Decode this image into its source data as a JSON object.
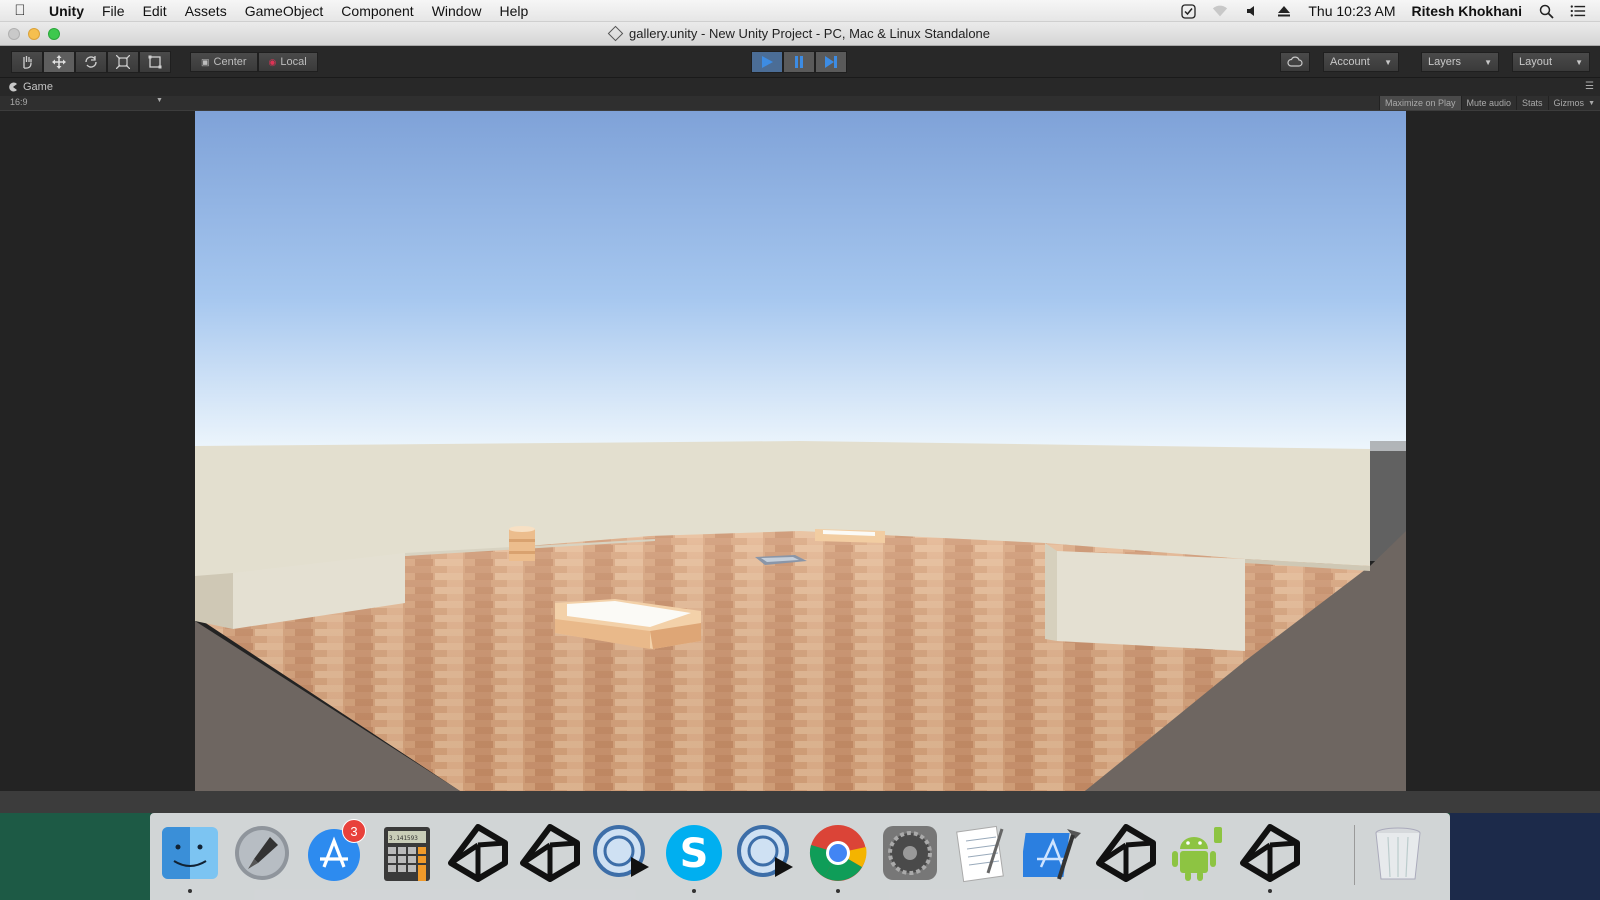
{
  "menubar": {
    "app": "Unity",
    "items": [
      "File",
      "Edit",
      "Assets",
      "GameObject",
      "Component",
      "Window",
      "Help"
    ],
    "clock": "Thu 10:23 AM",
    "user": "Ritesh Khokhani"
  },
  "window": {
    "title": "gallery.unity - New Unity Project - PC, Mac & Linux Standalone"
  },
  "toolbar": {
    "tools": [
      "hand-icon",
      "move-icon",
      "rotate-icon",
      "scale-icon",
      "rect-icon"
    ],
    "pivot_center": "Center",
    "pivot_local": "Local",
    "play_state": "playing",
    "account": "Account",
    "layers": "Layers",
    "layout": "Layout"
  },
  "game_view": {
    "tab_label": "Game",
    "aspect": "16:9",
    "maximize_on_play": "Maximize on Play",
    "mute_audio": "Mute audio",
    "stats": "Stats",
    "gizmos": "Gizmos"
  },
  "dock": {
    "apps": [
      {
        "name": "Finder",
        "icon": "finder-icon",
        "running": true
      },
      {
        "name": "Launchpad",
        "icon": "launchpad-icon",
        "running": false
      },
      {
        "name": "App Store",
        "icon": "app-store-icon",
        "running": false,
        "badge": "3"
      },
      {
        "name": "Calculator",
        "icon": "calculator-icon",
        "running": false,
        "display": "3.141593"
      },
      {
        "name": "Unity",
        "icon": "unity-icon",
        "running": false
      },
      {
        "name": "Unity",
        "icon": "unity-icon",
        "running": false
      },
      {
        "name": "Remote Desktop",
        "icon": "remote-desktop-icon",
        "running": false
      },
      {
        "name": "Skype",
        "icon": "skype-icon",
        "running": true
      },
      {
        "name": "Remote Desktop",
        "icon": "remote-desktop-icon",
        "running": false
      },
      {
        "name": "Chrome",
        "icon": "chrome-icon",
        "running": true
      },
      {
        "name": "System Preferences",
        "icon": "system-preferences-icon",
        "running": false
      },
      {
        "name": "TextEdit",
        "icon": "textedit-icon",
        "running": false
      },
      {
        "name": "Xcode",
        "icon": "xcode-icon",
        "running": false
      },
      {
        "name": "Unity",
        "icon": "unity-icon",
        "running": false
      },
      {
        "name": "Android File Transfer",
        "icon": "android-icon",
        "running": false
      },
      {
        "name": "Unity",
        "icon": "unity-icon",
        "running": true
      },
      {
        "name": "Trash",
        "icon": "trash-icon",
        "running": false
      }
    ]
  }
}
